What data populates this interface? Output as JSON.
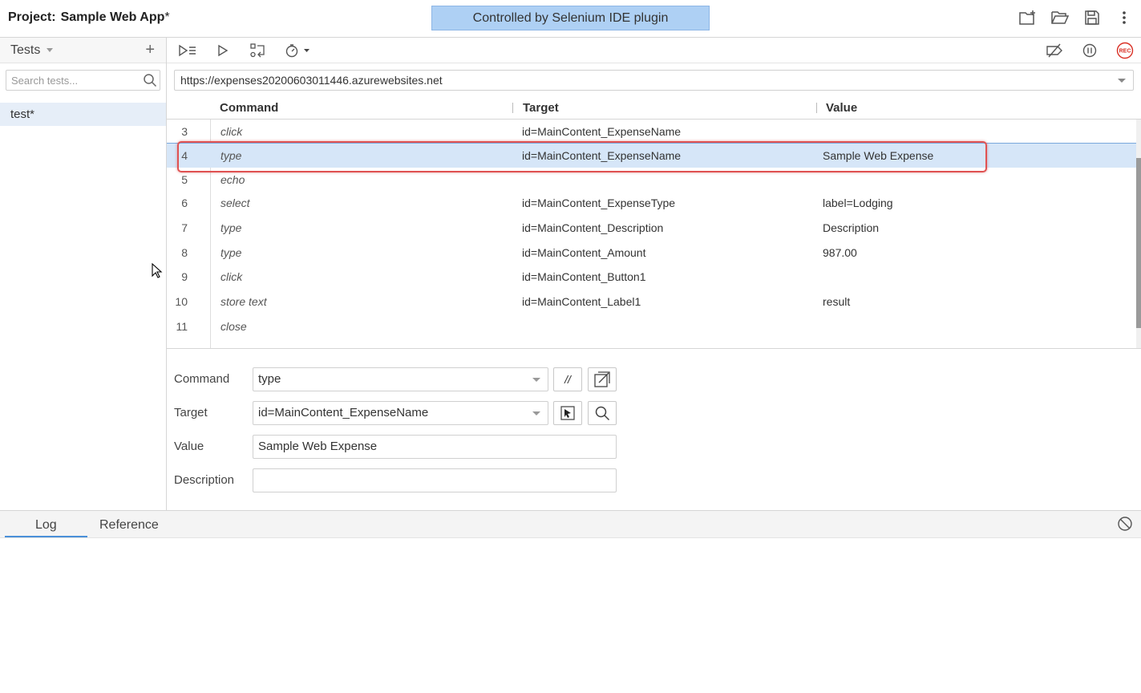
{
  "title": {
    "project_label": "Project:",
    "project_name": "Sample Web App",
    "modified_mark": "*",
    "banner": "Controlled by Selenium IDE plugin"
  },
  "sidebar": {
    "title": "Tests",
    "search_placeholder": "Search tests...",
    "tests": [
      {
        "label": "test*"
      }
    ]
  },
  "url": "https://expenses20200603011446.azurewebsites.net",
  "grid": {
    "headers": {
      "command": "Command",
      "target": "Target",
      "value": "Value"
    },
    "rows": [
      {
        "num": "3",
        "command": "click",
        "target": "id=MainContent_ExpenseName",
        "value": ""
      },
      {
        "num": "4",
        "command": "type",
        "target": "id=MainContent_ExpenseName",
        "value": "Sample Web Expense"
      },
      {
        "num": "5",
        "command": "echo",
        "target": "",
        "value": ""
      },
      {
        "num": "6",
        "command": "select",
        "target": "id=MainContent_ExpenseType",
        "value": "label=Lodging"
      },
      {
        "num": "7",
        "command": "type",
        "target": "id=MainContent_Description",
        "value": "Description"
      },
      {
        "num": "8",
        "command": "type",
        "target": "id=MainContent_Amount",
        "value": "987.00"
      },
      {
        "num": "9",
        "command": "click",
        "target": "id=MainContent_Button1",
        "value": ""
      },
      {
        "num": "10",
        "command": "store text",
        "target": "id=MainContent_Label1",
        "value": "result"
      },
      {
        "num": "11",
        "command": "close",
        "target": "",
        "value": ""
      }
    ]
  },
  "editor": {
    "command_label": "Command",
    "command_value": "type",
    "comment_button": "//",
    "target_label": "Target",
    "target_value": "id=MainContent_ExpenseName",
    "value_label": "Value",
    "value_value": "Sample Web Expense",
    "description_label": "Description",
    "description_value": ""
  },
  "bottom": {
    "tabs": [
      {
        "label": "Log"
      },
      {
        "label": "Reference"
      }
    ]
  },
  "colors": {
    "banner_bg": "#aed0f4",
    "selected_row": "#d6e6f8",
    "highlight_border": "#e05252",
    "rec": "#d93025",
    "tab_accent": "#4a90d9"
  }
}
